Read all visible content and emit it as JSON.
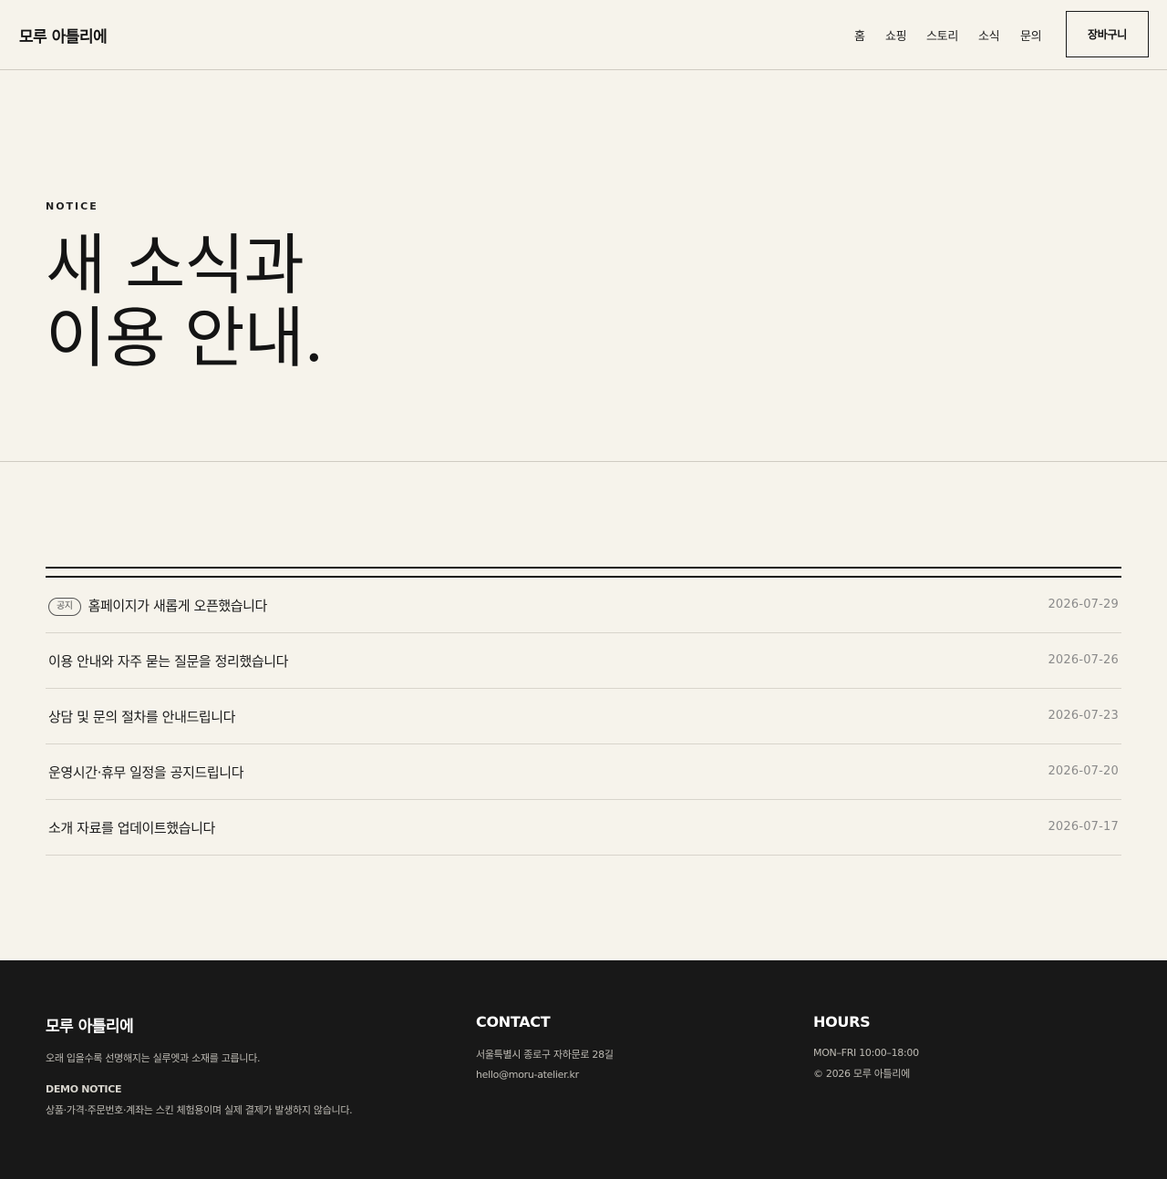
{
  "header": {
    "brand": "모루 아틀리에",
    "nav": [
      "홈",
      "쇼핑",
      "스토리",
      "소식",
      "문의"
    ],
    "cart_label": "장바구니"
  },
  "hero": {
    "eyebrow": "NOTICE",
    "title_line1": "새 소식과",
    "title_line2": "이용 안내."
  },
  "notices": [
    {
      "badge": "공지",
      "title": "홈페이지가 새롭게 오픈했습니다",
      "date": "2026-07-29"
    },
    {
      "badge": "",
      "title": "이용 안내와 자주 묻는 질문을 정리했습니다",
      "date": "2026-07-26"
    },
    {
      "badge": "",
      "title": "상담 및 문의 절차를 안내드립니다",
      "date": "2026-07-23"
    },
    {
      "badge": "",
      "title": "운영시간·휴무 일정을 공지드립니다",
      "date": "2026-07-20"
    },
    {
      "badge": "",
      "title": "소개 자료를 업데이트했습니다",
      "date": "2026-07-17"
    }
  ],
  "footer": {
    "brand": "모루 아틀리에",
    "tagline": "오래 입을수록 선명해지는 실루엣과 소재를 고릅니다.",
    "demo_label": "DEMO NOTICE",
    "demo_text": "상품·가격·주문번호·계좌는 스킨 체험용이며 실제 결제가 발생하지 않습니다.",
    "contact_heading": "CONTACT",
    "address": "서울특별시 종로구 자하문로 28길",
    "email": "hello@moru-atelier.kr",
    "hours_heading": "HOURS",
    "hours": "MON–FRI 10:00–18:00",
    "copyright": "© 2026 모루 아틀리에"
  }
}
